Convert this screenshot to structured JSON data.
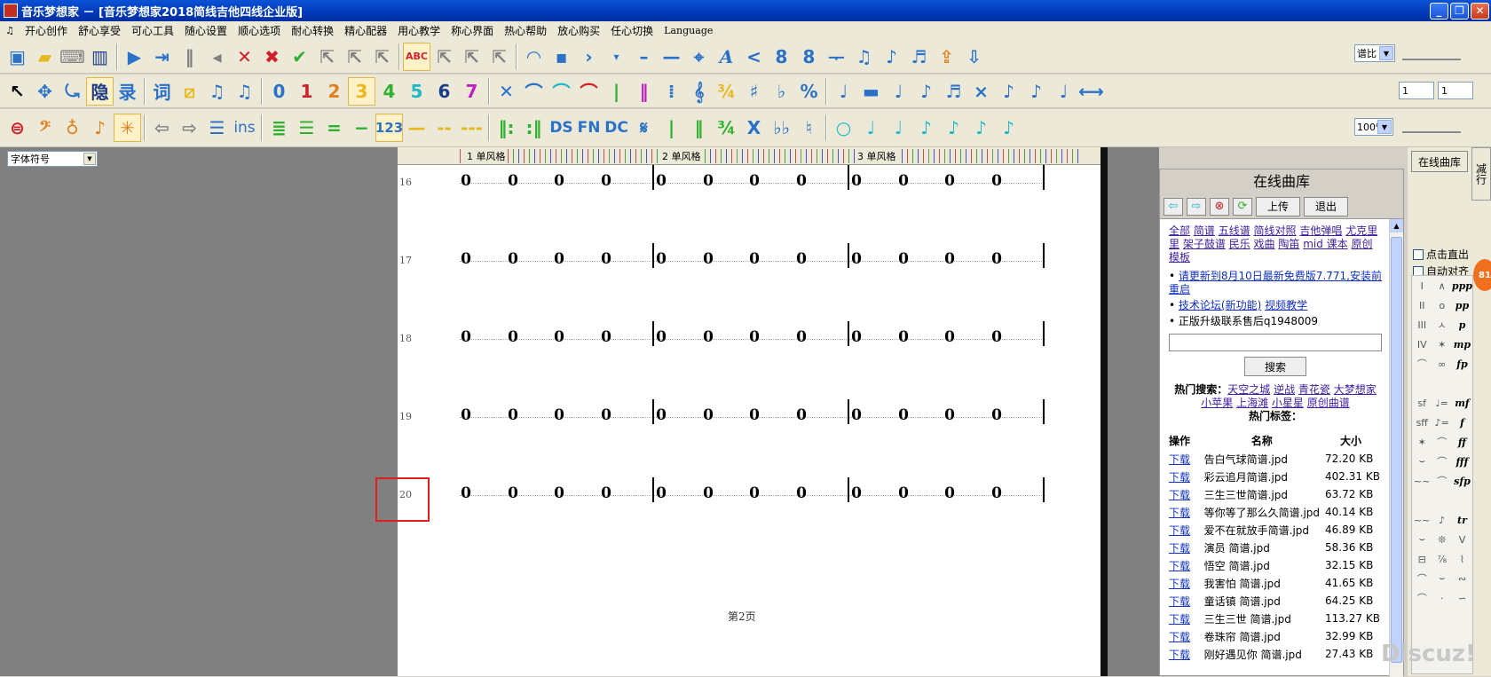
{
  "window": {
    "title": "音乐梦想家 － [音乐梦想家2018简线吉他四线企业版]",
    "controls": [
      "_",
      "❐",
      "✕"
    ]
  },
  "menu": [
    "开心创作",
    "舒心享受",
    "可心工具",
    "随心设置",
    "顺心选项",
    "耐心转换",
    "精心配器",
    "用心教学",
    "称心界面",
    "热心帮助",
    "放心购买",
    "任心切换",
    "Language"
  ],
  "toolbar": {
    "mode_hide": "隐",
    "mode_record": "录",
    "mode_lyric": "词",
    "notes_digits": [
      "0",
      "1",
      "2",
      "3",
      "4",
      "5",
      "6",
      "7"
    ],
    "ins_label": "ins",
    "num_label": "123",
    "ds": "DS",
    "fn": "FN",
    "dc": "DC",
    "ratio_select": "谱比",
    "zoom_select": "100%",
    "field_a": "1",
    "field_b": "1"
  },
  "font_select": "字体符号",
  "ruler": {
    "labels": [
      "1 单风格",
      "2 单风格",
      "3 单风格"
    ]
  },
  "score": {
    "rows": [
      {
        "num": "16"
      },
      {
        "num": "17"
      },
      {
        "num": "18"
      },
      {
        "num": "19"
      },
      {
        "num": "20"
      }
    ],
    "note_value": "0",
    "page_label": "第2页"
  },
  "online": {
    "title": "在线曲库",
    "upload": "上传",
    "exit": "退出",
    "categories": [
      "全部",
      "简谱",
      "五线谱",
      "简线对照",
      "吉他弹唱",
      "尤克里里",
      "架子鼓谱",
      "民乐",
      "戏曲",
      "陶笛",
      "mid 课本",
      "原创",
      "模板"
    ],
    "bullets": [
      {
        "text": "请更新到8月10日最新免费版7.771,安装前重启",
        "link": true
      },
      {
        "text": "技术论坛(新功能)",
        "link": true,
        "extra": "视频教学"
      },
      {
        "text": "正版升级联系售后q1948009",
        "link": false
      }
    ],
    "search_button": "搜索",
    "hot_search_label": "热门搜索：",
    "hot_searches": [
      "天空之城",
      "逆战",
      "青花瓷",
      "大梦想家",
      "小苹果",
      "上海滩",
      "小星星",
      "原创曲谱"
    ],
    "hot_tags_label": "热门标签：",
    "table_headers": [
      "操作",
      "名称",
      "大小"
    ],
    "download_label": "下载",
    "files": [
      {
        "name": "告白气球简谱.jpd",
        "size": "72.20 KB"
      },
      {
        "name": "彩云追月简谱.jpd",
        "size": "402.31 KB"
      },
      {
        "name": "三生三世简谱.jpd",
        "size": "63.72 KB"
      },
      {
        "name": "等你等了那么久简谱.jpd",
        "size": "40.14 KB"
      },
      {
        "name": "爱不在就放手简谱.jpd",
        "size": "46.89 KB"
      },
      {
        "name": "演员 简谱.jpd",
        "size": "58.36 KB"
      },
      {
        "name": "悟空 简谱.jpd",
        "size": "32.15 KB"
      },
      {
        "name": "我害怕 简谱.jpd",
        "size": "41.65 KB"
      },
      {
        "name": "童话镇 简谱.jpd",
        "size": "64.25 KB"
      },
      {
        "name": "三生三世 简谱.jpd",
        "size": "113.27 KB"
      },
      {
        "name": "卷珠帘 简谱.jpd",
        "size": "32.99 KB"
      },
      {
        "name": "刚好遇见你 简谱.jpd",
        "size": "27.43 KB"
      }
    ]
  },
  "right_panel": {
    "online_button": "在线曲库",
    "side_tab": "减行",
    "check_click_input": "点击直出",
    "check_auto_align": "自动对齐",
    "badge": "81",
    "palette": [
      "I",
      "∧",
      "ppp",
      "II",
      "o",
      "pp",
      "III",
      "ㅅ",
      "p",
      "IV",
      "✶",
      "mp",
      "⌒",
      "∞",
      "fp",
      "",
      "",
      "",
      "sf",
      "♩=",
      "mf",
      "sff",
      "♪=",
      "f",
      "✶",
      "⌒",
      "ff",
      "⌣",
      "⌒",
      "fff",
      "~~",
      "⌒",
      "sfp",
      "",
      "",
      "",
      "~~",
      "♪",
      "tr",
      "⌣",
      "❊",
      "V",
      "⊟",
      "⅞",
      "⌇",
      "⌒",
      "⌣",
      "∾",
      "⌒",
      "·",
      "∽"
    ],
    "watermark": "Discuz!"
  },
  "colors": {
    "title_bar": "#0a52d6",
    "toolbar_bg": "#ece9d8",
    "workspace_gray": "#808080",
    "highlight_box": "#e02020"
  }
}
